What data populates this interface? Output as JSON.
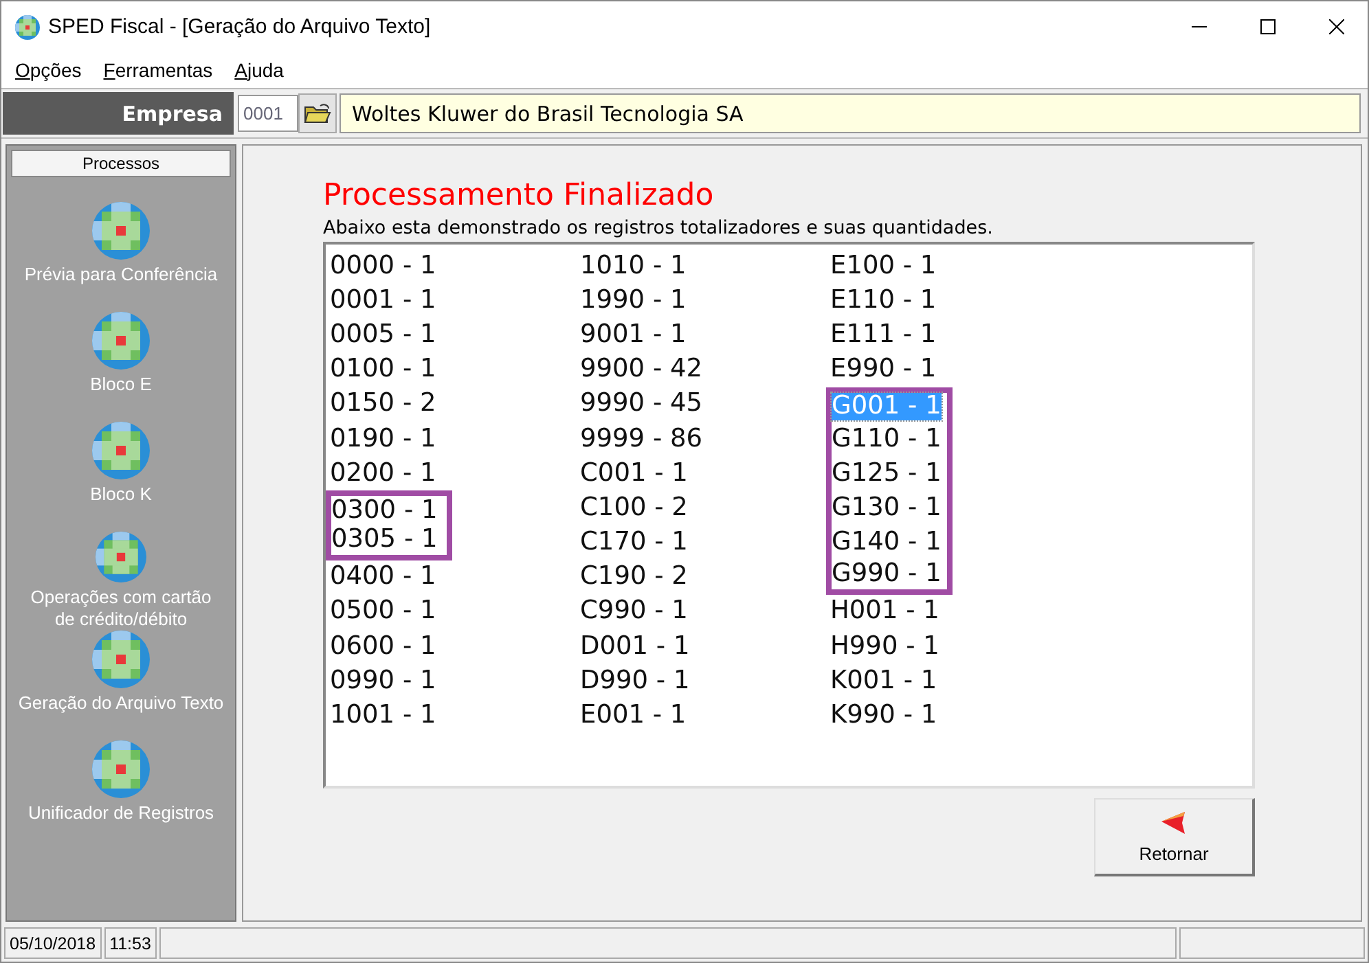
{
  "window": {
    "title": "SPED Fiscal - [Geração do Arquivo Texto]"
  },
  "menu": [
    {
      "label": "Opções"
    },
    {
      "label": "Ferramentas"
    },
    {
      "label": "Ajuda"
    }
  ],
  "company": {
    "label": "Empresa",
    "code": "0001",
    "name": "Woltes Kluwer do Brasil Tecnologia SA"
  },
  "sidebar": {
    "title": "Processos",
    "items": [
      {
        "label": "Prévia para Conferência"
      },
      {
        "label": "Bloco E"
      },
      {
        "label": "Bloco K"
      },
      {
        "label": "Operações com cartão de crédito/débito"
      },
      {
        "label": "Geração do Arquivo Texto"
      },
      {
        "label": "Unificador de Registros"
      }
    ]
  },
  "main": {
    "heading": "Processamento Finalizado",
    "description": "Abaixo esta demonstrado os registros totalizadores e suas quantidades.",
    "columns": [
      [
        {
          "text": "0000 - 1",
          "selected": false,
          "marked": false
        },
        {
          "text": "0001 - 1",
          "selected": false,
          "marked": false
        },
        {
          "text": "0005 - 1",
          "selected": false,
          "marked": false
        },
        {
          "text": "0100 - 1",
          "selected": false,
          "marked": false
        },
        {
          "text": "0150 - 2",
          "selected": false,
          "marked": false
        },
        {
          "text": "0190 - 1",
          "selected": false,
          "marked": false
        },
        {
          "text": "0200 - 1",
          "selected": false,
          "marked": false
        },
        {
          "text": "0300 - 1",
          "selected": false,
          "marked": true
        },
        {
          "text": "0305 - 1",
          "selected": false,
          "marked": true
        },
        {
          "text": "0400 - 1",
          "selected": false,
          "marked": false
        },
        {
          "text": "0500 - 1",
          "selected": false,
          "marked": false
        },
        {
          "text": "0600 - 1",
          "selected": false,
          "marked": false
        },
        {
          "text": "0990 - 1",
          "selected": false,
          "marked": false
        },
        {
          "text": "1001 - 1",
          "selected": false,
          "marked": false
        }
      ],
      [
        {
          "text": "1010 - 1",
          "selected": false,
          "marked": false
        },
        {
          "text": "1990 - 1",
          "selected": false,
          "marked": false
        },
        {
          "text": "9001 - 1",
          "selected": false,
          "marked": false
        },
        {
          "text": "9900 - 42",
          "selected": false,
          "marked": false
        },
        {
          "text": "9990 - 45",
          "selected": false,
          "marked": false
        },
        {
          "text": "9999 - 86",
          "selected": false,
          "marked": false
        },
        {
          "text": "C001 - 1",
          "selected": false,
          "marked": false
        },
        {
          "text": "C100 - 2",
          "selected": false,
          "marked": false
        },
        {
          "text": "C170 - 1",
          "selected": false,
          "marked": false
        },
        {
          "text": "C190 - 2",
          "selected": false,
          "marked": false
        },
        {
          "text": "C990 - 1",
          "selected": false,
          "marked": false
        },
        {
          "text": "D001 - 1",
          "selected": false,
          "marked": false
        },
        {
          "text": "D990 - 1",
          "selected": false,
          "marked": false
        },
        {
          "text": "E001 - 1",
          "selected": false,
          "marked": false
        }
      ],
      [
        {
          "text": "E100 - 1",
          "selected": false,
          "marked": false
        },
        {
          "text": "E110 - 1",
          "selected": false,
          "marked": false
        },
        {
          "text": "E111 - 1",
          "selected": false,
          "marked": false
        },
        {
          "text": "E990 - 1",
          "selected": false,
          "marked": false
        },
        {
          "text": "G001 - 1",
          "selected": true,
          "marked": true
        },
        {
          "text": "G110 - 1",
          "selected": false,
          "marked": true
        },
        {
          "text": "G125 - 1",
          "selected": false,
          "marked": true
        },
        {
          "text": "G130 - 1",
          "selected": false,
          "marked": true
        },
        {
          "text": "G140 - 1",
          "selected": false,
          "marked": true
        },
        {
          "text": "G990 - 1",
          "selected": false,
          "marked": true
        },
        {
          "text": "H001 - 1",
          "selected": false,
          "marked": false
        },
        {
          "text": "H990 - 1",
          "selected": false,
          "marked": false
        },
        {
          "text": "K001 - 1",
          "selected": false,
          "marked": false
        },
        {
          "text": "K990 - 1",
          "selected": false,
          "marked": false
        }
      ]
    ],
    "button": "Retornar"
  },
  "status_bar": {
    "date": "05/10/2018",
    "time": "11:53"
  }
}
